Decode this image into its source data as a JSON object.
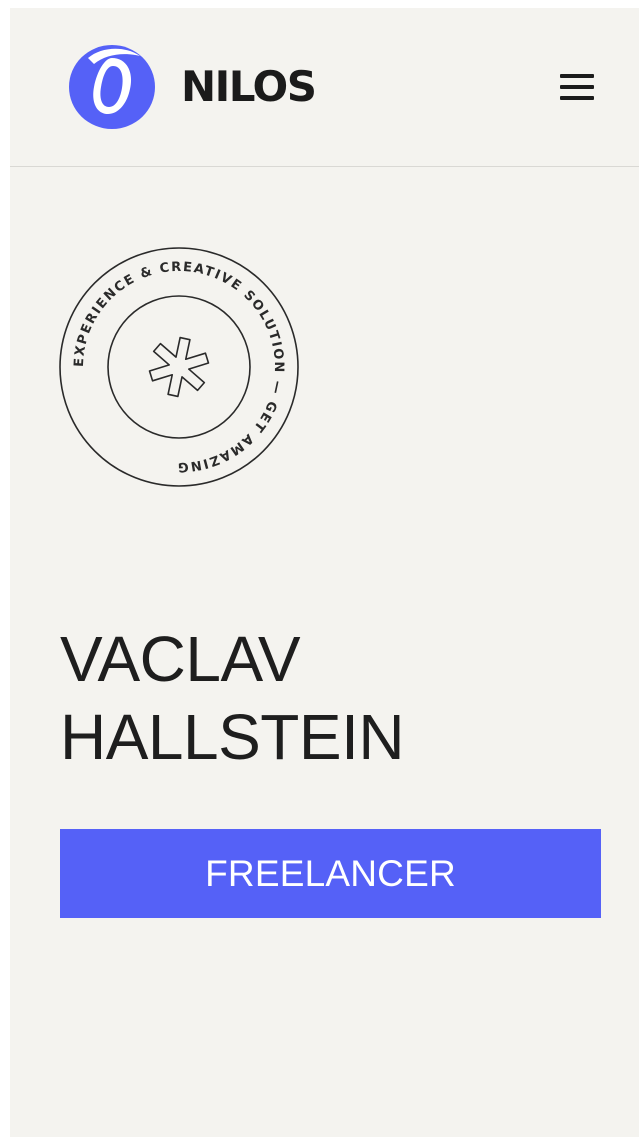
{
  "header": {
    "logo_text": "NILOS",
    "logo_icon": "circle-swirl-logo",
    "menu_icon": "hamburger-menu-icon"
  },
  "badge": {
    "ring_text": "EXPERIENCE & CREATIVE SOLUTION — GET AMAZING ",
    "center_icon": "asterisk-icon"
  },
  "hero": {
    "name_line1": "VACLAV",
    "name_line2": "HALLSTEIN",
    "role": "FREELANCER"
  },
  "colors": {
    "accent": "#5561f7",
    "background": "#f4f3ef",
    "text": "#1e1e1e"
  }
}
